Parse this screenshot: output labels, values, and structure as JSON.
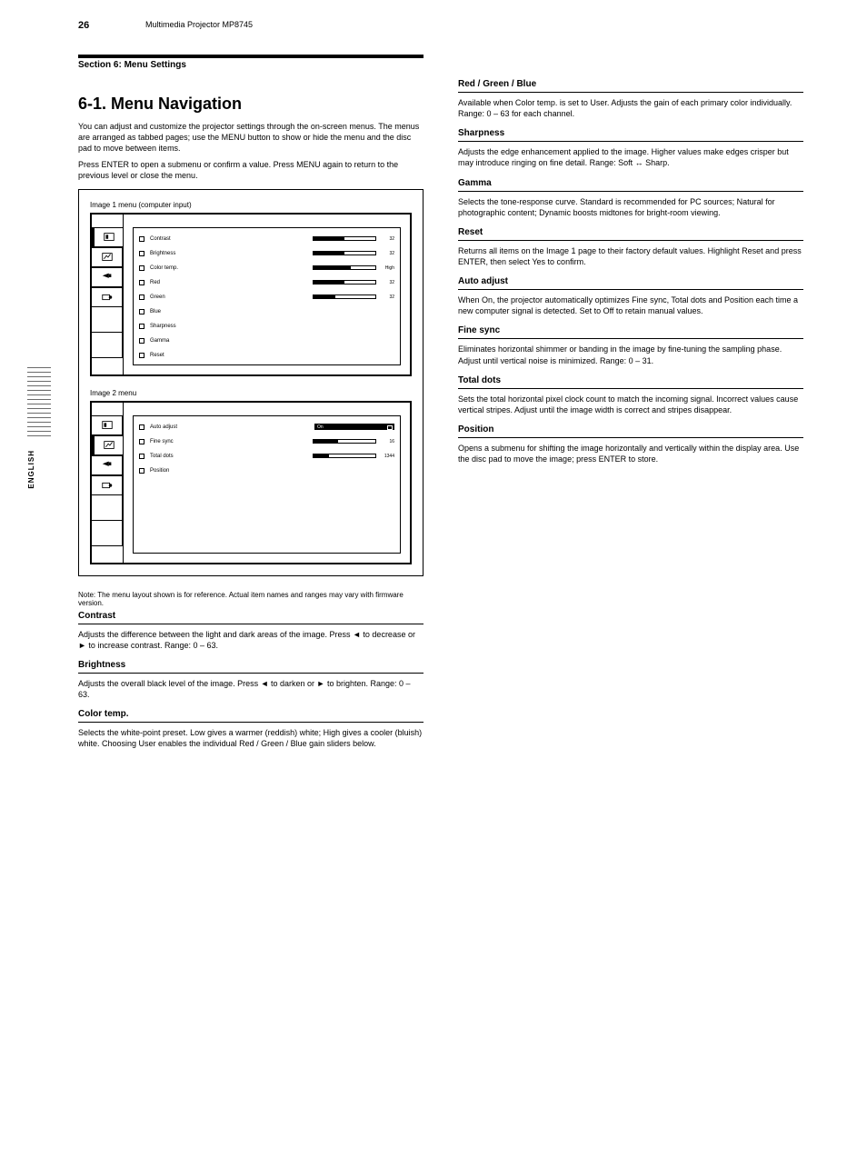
{
  "page_number": "26",
  "product_line": "Multimedia Projector  MP8745",
  "chapter": "Section 6: Menu Settings",
  "side_label": "ENGLISH",
  "intro_heading": "6-1. Menu Navigation",
  "intro_p1": "You can adjust and customize the projector settings through the on-screen menus. The menus are arranged as tabbed pages; use the MENU button to show or hide the menu and the disc pad to move between items.",
  "intro_p2": "Press ENTER to open a submenu or confirm a value. Press MENU again to return to the previous level or close the menu.",
  "screenshot_note": "Note: The menu layout shown is for reference. Actual item names and ranges may vary with firmware version.",
  "screenshot1": {
    "label": "Image 1 menu (computer input)",
    "rows": [
      {
        "name": "Contrast",
        "type": "bar",
        "fill": 50,
        "value": "32"
      },
      {
        "name": "Brightness",
        "type": "bar",
        "fill": 50,
        "value": "32"
      },
      {
        "name": "Color temp.",
        "type": "bar",
        "fill": 60,
        "value": "High"
      },
      {
        "name": "Red",
        "type": "bar",
        "fill": 50,
        "value": "32"
      },
      {
        "name": "Green",
        "type": "bar",
        "fill": 35,
        "value": "32"
      },
      {
        "name": "Blue",
        "type": "plain"
      },
      {
        "name": "Sharpness",
        "type": "plain"
      },
      {
        "name": "Gamma",
        "type": "plain"
      },
      {
        "name": "Reset",
        "type": "plain"
      }
    ]
  },
  "screenshot2": {
    "label": "Image 2 menu",
    "rows": [
      {
        "name": "Auto adjust",
        "type": "dropdown",
        "value": "On",
        "filled": true
      },
      {
        "name": "Fine sync",
        "type": "split",
        "value": "16"
      },
      {
        "name": "Total dots",
        "type": "split2",
        "value": "1344"
      },
      {
        "name": "Position",
        "type": "plain"
      }
    ]
  },
  "left_settings": [
    {
      "title": "Contrast",
      "desc": "Adjusts the difference between the light and dark areas of the image. Press ◄ to decrease or ► to increase contrast. Range: 0 – 63."
    },
    {
      "title": "Brightness",
      "desc": "Adjusts the overall black level of the image. Press ◄ to darken or ► to brighten. Range: 0 – 63."
    },
    {
      "title": "Color temp.",
      "desc": "Selects the white-point preset. Low gives a warmer (reddish) white; High gives a cooler (bluish) white. Choosing User enables the individual Red / Green / Blue gain sliders below."
    }
  ],
  "right_settings": [
    {
      "title": "Red / Green / Blue",
      "desc": "Available when Color temp. is set to User. Adjusts the gain of each primary color individually. Range: 0 – 63 for each channel."
    },
    {
      "title": "Sharpness",
      "desc": "Adjusts the edge enhancement applied to the image. Higher values make edges crisper but may introduce ringing on fine detail. Range: Soft ↔ Sharp."
    },
    {
      "title": "Gamma",
      "desc": "Selects the tone-response curve. Standard is recommended for PC sources; Natural for photographic content; Dynamic boosts midtones for bright-room viewing."
    },
    {
      "title": "Reset",
      "desc": "Returns all items on the Image 1 page to their factory default values. Highlight Reset and press ENTER, then select Yes to confirm."
    },
    {
      "title": "Auto adjust",
      "desc": "When On, the projector automatically optimizes Fine sync, Total dots and Position each time a new computer signal is detected. Set to Off to retain manual values."
    },
    {
      "title": "Fine sync",
      "desc": "Eliminates horizontal shimmer or banding in the image by fine-tuning the sampling phase. Adjust until vertical noise is minimized. Range: 0 – 31."
    },
    {
      "title": "Total dots",
      "desc": "Sets the total horizontal pixel clock count to match the incoming signal. Incorrect values cause vertical stripes. Adjust until the image width is correct and stripes disappear."
    },
    {
      "title": "Position",
      "desc": "Opens a submenu for shifting the image horizontally and vertically within the display area. Use the disc pad to move the image; press ENTER to store."
    }
  ]
}
